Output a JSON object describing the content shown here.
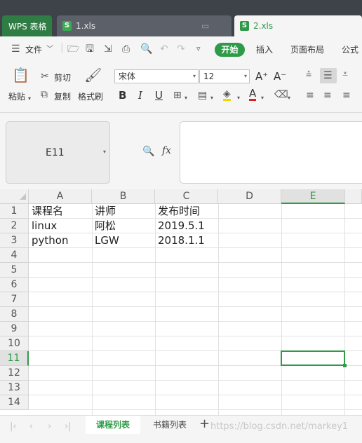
{
  "tabs": [
    {
      "label": "WPS 表格"
    },
    {
      "label": "1.xls"
    },
    {
      "label": "2.xls"
    }
  ],
  "menu": {
    "file": "文件",
    "start": "开始",
    "insert": "插入",
    "page_layout": "页面布局",
    "formula": "公式"
  },
  "ribbon": {
    "paste": "粘贴",
    "cut": "剪切",
    "copy": "复制",
    "format_painter": "格式刷",
    "font_name": "宋体",
    "font_size": "12",
    "bold": "B",
    "italic": "I",
    "underline": "U",
    "font_color_letter": "A",
    "grow_font": "A⁺",
    "shrink_font": "A⁻"
  },
  "formula_bar": {
    "cell_ref": "E11",
    "fx": "fx",
    "content": ""
  },
  "grid": {
    "columns": [
      "A",
      "B",
      "C",
      "D",
      "E"
    ],
    "rows": [
      "1",
      "2",
      "3",
      "4",
      "5",
      "6",
      "7",
      "8",
      "9",
      "10",
      "11",
      "12",
      "13",
      "14"
    ],
    "cells": [
      [
        "课程名",
        "讲师",
        "发布时间"
      ],
      [
        "linux",
        "阿松",
        "2019.5.1"
      ],
      [
        "python",
        "LGW",
        "2018.1.1"
      ]
    ],
    "selected_cell": "E11"
  },
  "sheets": [
    {
      "label": "课程列表"
    },
    {
      "label": "书籍列表"
    }
  ],
  "watermark": "https://blog.csdn.net/markey1",
  "colors": {
    "accent": "#2f9a48",
    "tabbar": "#3e4249"
  }
}
